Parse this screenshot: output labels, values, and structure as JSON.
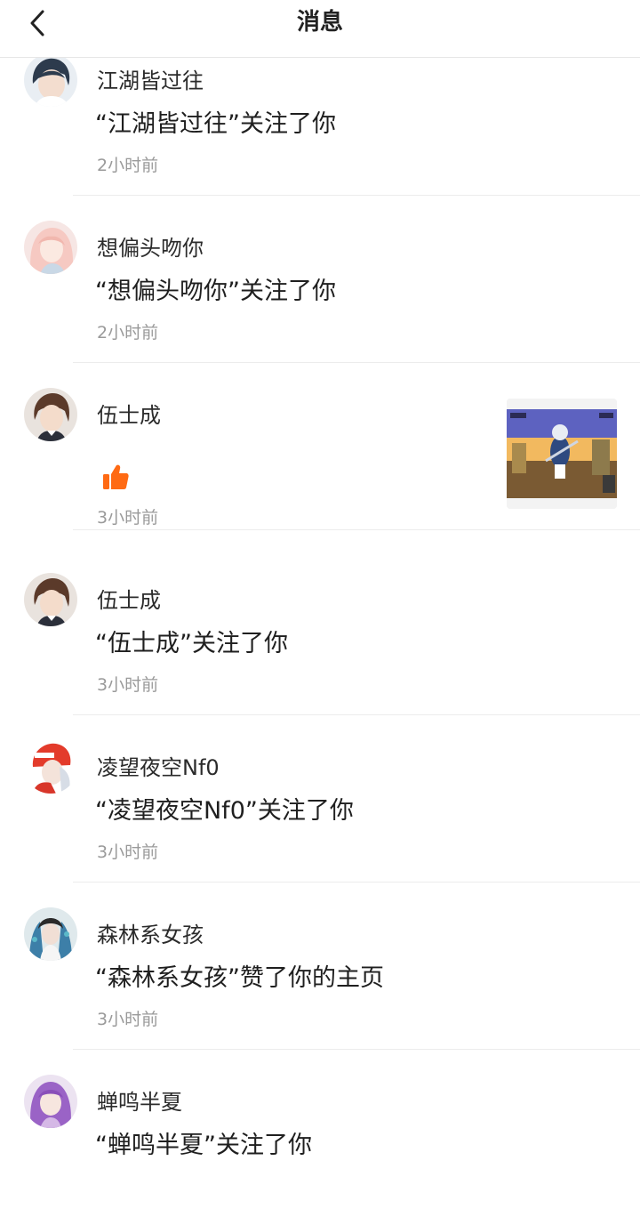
{
  "header": {
    "title": "消息"
  },
  "messages": [
    {
      "username": "江湖皆过往",
      "text": "“江湖皆过往”关注了你",
      "time": "2小时前"
    },
    {
      "username": "想偏头吻你",
      "text": "“想偏头吻你”关注了你",
      "time": "2小时前"
    },
    {
      "username": "伍士成",
      "text": "",
      "time": "3小时前",
      "icon": "thumbs-up-icon"
    },
    {
      "username": "伍士成",
      "text": "“伍士成”关注了你",
      "time": "3小时前"
    },
    {
      "username": "凌望夜空Nf0",
      "text": "“凌望夜空Nf0”关注了你",
      "time": "3小时前"
    },
    {
      "username": "森林系女孩",
      "text": "“森林系女孩”赞了你的主页",
      "time": "3小时前"
    },
    {
      "username": "蝉鸣半夏",
      "text": "“蝉鸣半夏”关注了你",
      "time": ""
    }
  ],
  "colors": {
    "like": "#ff6a13",
    "divider": "#ececec",
    "time": "#9a9a9a"
  }
}
